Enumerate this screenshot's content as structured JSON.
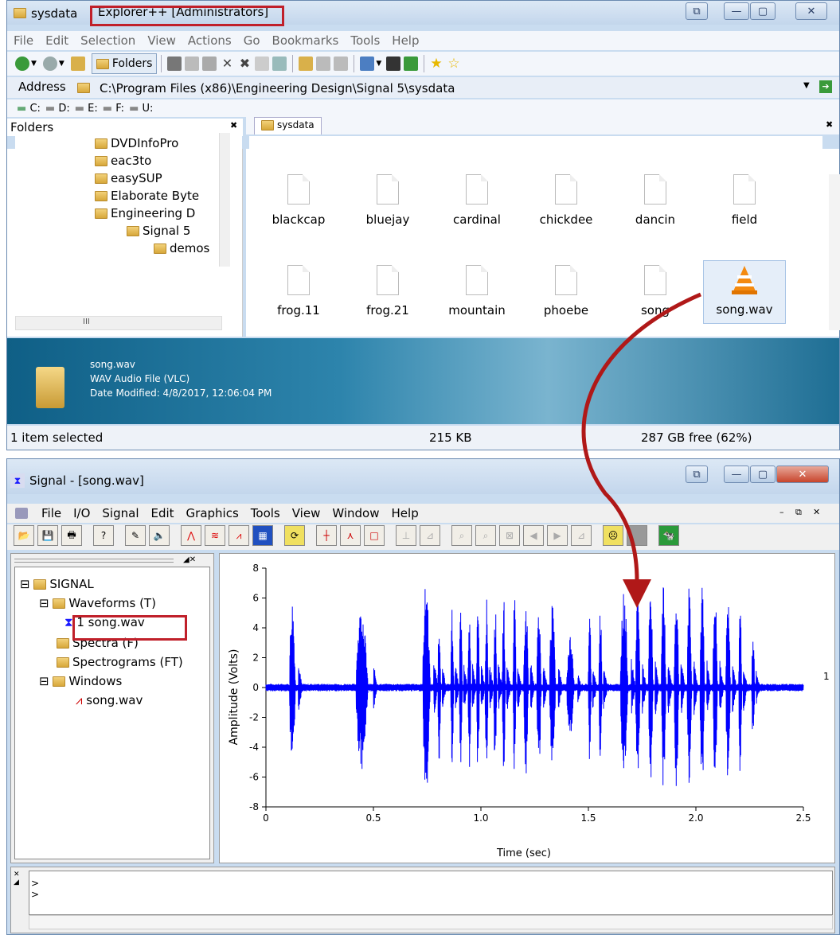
{
  "explorer": {
    "title_folder": "sysdata",
    "title_app": "Explorer++ [Administrators]",
    "menu": [
      "File",
      "Edit",
      "Selection",
      "View",
      "Actions",
      "Go",
      "Bookmarks",
      "Tools",
      "Help"
    ],
    "folders_button": "Folders",
    "address_label": "Address",
    "address_value": "C:\\Program Files (x86)\\Engineering Design\\Signal 5\\sysdata",
    "drives": [
      "C:",
      "D:",
      "E:",
      "F:",
      "U:"
    ],
    "folders_pane_title": "Folders",
    "tree": [
      "DVDInfoPro",
      "eac3to",
      "easySUP",
      "Elaborate Byte",
      "Engineering D",
      "Signal 5",
      "demos"
    ],
    "tab_label": "sysdata",
    "files_row1": [
      "blackcap",
      "bluejay",
      "cardinal",
      "chickdee",
      "dancin",
      "field"
    ],
    "files_row2": [
      "frog.11",
      "frog.21",
      "mountain",
      "phoebe",
      "song",
      "song.wav"
    ],
    "info_name": "song.wav",
    "info_type": "WAV Audio File (VLC)",
    "info_date": "Date Modified: 4/8/2017, 12:06:04 PM",
    "status_left": "1 item selected",
    "status_size": "215 KB",
    "status_free": "287 GB free (62%)",
    "scroll_mark": "III"
  },
  "signal": {
    "title": "Signal - [song.wav]",
    "menu": [
      "File",
      "I/O",
      "Signal",
      "Edit",
      "Graphics",
      "Tools",
      "View",
      "Window",
      "Help"
    ],
    "tree_root": "SIGNAL",
    "tree_waveforms": "Waveforms (T)",
    "tree_song_num": "1",
    "tree_song": "song.wav",
    "tree_spectra": "Spectra (F)",
    "tree_spectrograms": "Spectrograms (FT)",
    "tree_windows": "Windows",
    "tree_window_song": "song.wav",
    "trace_label": "1",
    "console_prompts": [
      ">",
      ">"
    ]
  },
  "chart_data": {
    "type": "line",
    "title": "",
    "xlabel": "Time (sec)",
    "ylabel": "Amplitude (Volts)",
    "xlim": [
      0,
      2.5
    ],
    "ylim": [
      -8,
      8
    ],
    "xticks": [
      "0",
      "0.5",
      "1.0",
      "1.5",
      "2.0",
      "2.5"
    ],
    "yticks": [
      "8",
      "6",
      "4",
      "2",
      "0",
      "-2",
      "-4",
      "-6",
      "-8"
    ],
    "color": "#0000ff",
    "bursts": [
      {
        "start": 0.11,
        "end": 0.15,
        "peak": 6.0
      },
      {
        "start": 0.42,
        "end": 0.5,
        "peak": 5.5
      },
      {
        "start": 0.73,
        "end": 0.78,
        "peak": 7.3
      },
      {
        "start": 0.8,
        "end": 0.82,
        "peak": 5.0
      },
      {
        "start": 0.86,
        "end": 0.88,
        "peak": 5.5
      },
      {
        "start": 0.9,
        "end": 0.92,
        "peak": 5.6
      },
      {
        "start": 0.94,
        "end": 0.96,
        "peak": 5.8
      },
      {
        "start": 0.98,
        "end": 1.0,
        "peak": 5.9
      },
      {
        "start": 1.02,
        "end": 1.04,
        "peak": 6.0
      },
      {
        "start": 1.06,
        "end": 1.08,
        "peak": 6.1
      },
      {
        "start": 1.1,
        "end": 1.12,
        "peak": 6.1
      },
      {
        "start": 1.15,
        "end": 1.17,
        "peak": 6.2
      },
      {
        "start": 1.2,
        "end": 1.23,
        "peak": 6.4
      },
      {
        "start": 1.26,
        "end": 1.29,
        "peak": 5.8
      },
      {
        "start": 1.32,
        "end": 1.36,
        "peak": 5.6
      },
      {
        "start": 1.4,
        "end": 1.45,
        "peak": 3.5
      },
      {
        "start": 1.5,
        "end": 1.52,
        "peak": 5.0
      },
      {
        "start": 1.55,
        "end": 1.57,
        "peak": 5.5
      },
      {
        "start": 1.65,
        "end": 1.7,
        "peak": 6.5
      },
      {
        "start": 1.72,
        "end": 1.75,
        "peak": 6.6
      },
      {
        "start": 1.78,
        "end": 1.81,
        "peak": 6.8
      },
      {
        "start": 1.84,
        "end": 1.87,
        "peak": 6.9
      },
      {
        "start": 1.9,
        "end": 1.93,
        "peak": 6.9
      },
      {
        "start": 1.96,
        "end": 1.99,
        "peak": 7.0
      },
      {
        "start": 2.02,
        "end": 2.05,
        "peak": 6.8
      },
      {
        "start": 2.08,
        "end": 2.11,
        "peak": 6.6
      },
      {
        "start": 2.14,
        "end": 2.17,
        "peak": 6.3
      },
      {
        "start": 2.2,
        "end": 2.22,
        "peak": 6.0
      },
      {
        "start": 2.26,
        "end": 2.28,
        "peak": 4.0
      }
    ]
  }
}
